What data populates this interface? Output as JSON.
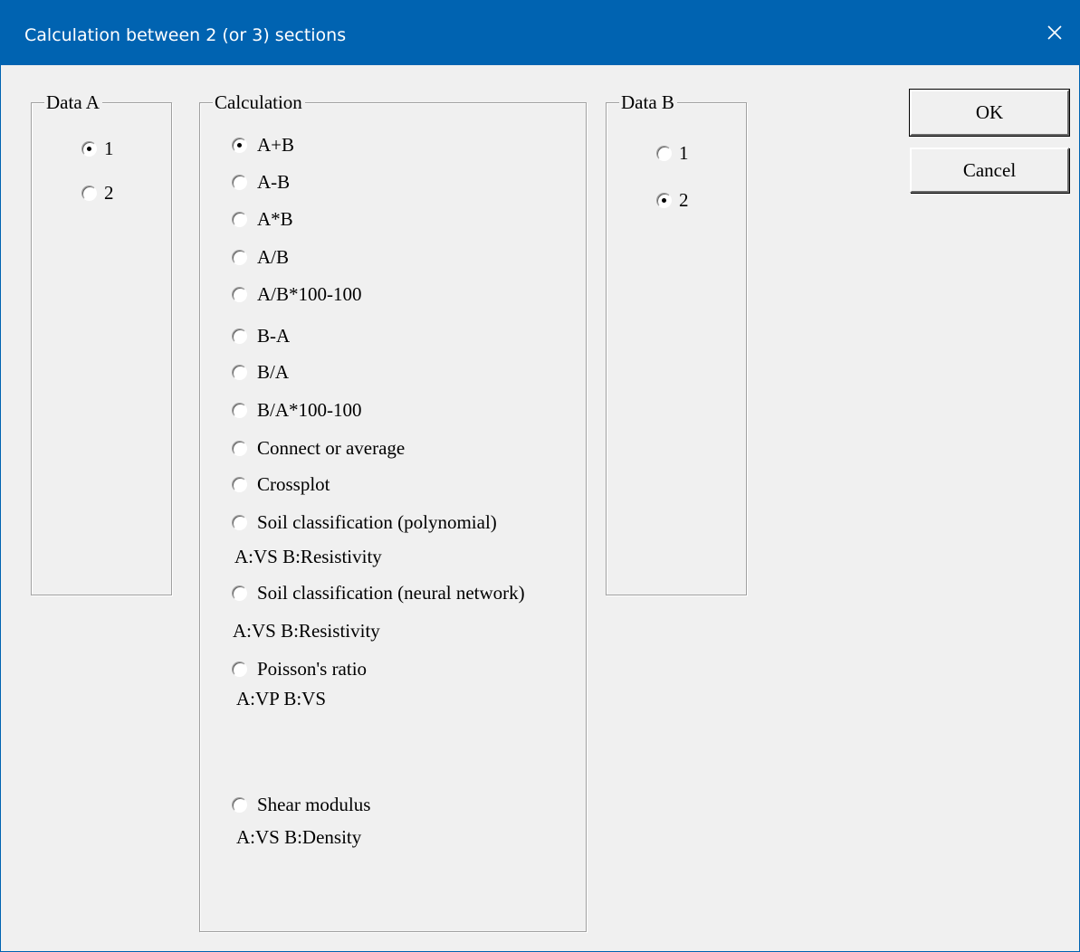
{
  "window": {
    "title": "Calculation between 2 (or 3) sections",
    "close_icon": "close-icon",
    "accent_color": "#0063b1"
  },
  "data_a": {
    "label": "Data A",
    "options": [
      {
        "label": "1",
        "checked": true
      },
      {
        "label": "2",
        "checked": false
      }
    ]
  },
  "calculation": {
    "label": "Calculation",
    "options": [
      {
        "label": "A+B",
        "checked": true
      },
      {
        "label": "A-B",
        "checked": false
      },
      {
        "label": "A*B",
        "checked": false
      },
      {
        "label": "A/B",
        "checked": false
      },
      {
        "label": "A/B*100-100",
        "checked": false
      },
      {
        "label": "B-A",
        "checked": false
      },
      {
        "label": "B/A",
        "checked": false
      },
      {
        "label": "B/A*100-100",
        "checked": false
      },
      {
        "label": "Connect or average",
        "checked": false
      },
      {
        "label": "Crossplot",
        "checked": false
      },
      {
        "label": "Soil classification (polynomial)",
        "checked": false
      },
      {
        "label": "Soil classification (neural network)",
        "checked": false
      },
      {
        "label": "Poisson's ratio",
        "checked": false
      },
      {
        "label": "Shear modulus",
        "checked": false
      }
    ],
    "notes": {
      "soil_poly": "A:VS B:Resistivity",
      "soil_nn": "A:VS B:Resistivity",
      "poisson": "A:VP B:VS",
      "shear": "A:VS B:Density"
    }
  },
  "data_b": {
    "label": "Data B",
    "options": [
      {
        "label": "1",
        "checked": false
      },
      {
        "label": "2",
        "checked": true
      }
    ]
  },
  "buttons": {
    "ok": "OK",
    "cancel": "Cancel"
  }
}
